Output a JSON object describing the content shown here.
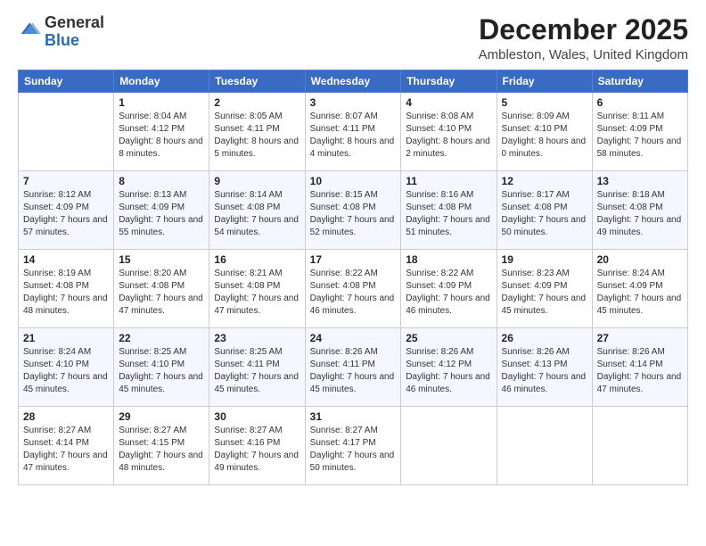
{
  "header": {
    "logo_general": "General",
    "logo_blue": "Blue",
    "month_title": "December 2025",
    "location": "Ambleston, Wales, United Kingdom"
  },
  "days_of_week": [
    "Sunday",
    "Monday",
    "Tuesday",
    "Wednesday",
    "Thursday",
    "Friday",
    "Saturday"
  ],
  "weeks": [
    [
      {
        "day": "",
        "sunrise": "",
        "sunset": "",
        "daylight": ""
      },
      {
        "day": "1",
        "sunrise": "Sunrise: 8:04 AM",
        "sunset": "Sunset: 4:12 PM",
        "daylight": "Daylight: 8 hours and 8 minutes."
      },
      {
        "day": "2",
        "sunrise": "Sunrise: 8:05 AM",
        "sunset": "Sunset: 4:11 PM",
        "daylight": "Daylight: 8 hours and 5 minutes."
      },
      {
        "day": "3",
        "sunrise": "Sunrise: 8:07 AM",
        "sunset": "Sunset: 4:11 PM",
        "daylight": "Daylight: 8 hours and 4 minutes."
      },
      {
        "day": "4",
        "sunrise": "Sunrise: 8:08 AM",
        "sunset": "Sunset: 4:10 PM",
        "daylight": "Daylight: 8 hours and 2 minutes."
      },
      {
        "day": "5",
        "sunrise": "Sunrise: 8:09 AM",
        "sunset": "Sunset: 4:10 PM",
        "daylight": "Daylight: 8 hours and 0 minutes."
      },
      {
        "day": "6",
        "sunrise": "Sunrise: 8:11 AM",
        "sunset": "Sunset: 4:09 PM",
        "daylight": "Daylight: 7 hours and 58 minutes."
      }
    ],
    [
      {
        "day": "7",
        "sunrise": "Sunrise: 8:12 AM",
        "sunset": "Sunset: 4:09 PM",
        "daylight": "Daylight: 7 hours and 57 minutes."
      },
      {
        "day": "8",
        "sunrise": "Sunrise: 8:13 AM",
        "sunset": "Sunset: 4:09 PM",
        "daylight": "Daylight: 7 hours and 55 minutes."
      },
      {
        "day": "9",
        "sunrise": "Sunrise: 8:14 AM",
        "sunset": "Sunset: 4:08 PM",
        "daylight": "Daylight: 7 hours and 54 minutes."
      },
      {
        "day": "10",
        "sunrise": "Sunrise: 8:15 AM",
        "sunset": "Sunset: 4:08 PM",
        "daylight": "Daylight: 7 hours and 52 minutes."
      },
      {
        "day": "11",
        "sunrise": "Sunrise: 8:16 AM",
        "sunset": "Sunset: 4:08 PM",
        "daylight": "Daylight: 7 hours and 51 minutes."
      },
      {
        "day": "12",
        "sunrise": "Sunrise: 8:17 AM",
        "sunset": "Sunset: 4:08 PM",
        "daylight": "Daylight: 7 hours and 50 minutes."
      },
      {
        "day": "13",
        "sunrise": "Sunrise: 8:18 AM",
        "sunset": "Sunset: 4:08 PM",
        "daylight": "Daylight: 7 hours and 49 minutes."
      }
    ],
    [
      {
        "day": "14",
        "sunrise": "Sunrise: 8:19 AM",
        "sunset": "Sunset: 4:08 PM",
        "daylight": "Daylight: 7 hours and 48 minutes."
      },
      {
        "day": "15",
        "sunrise": "Sunrise: 8:20 AM",
        "sunset": "Sunset: 4:08 PM",
        "daylight": "Daylight: 7 hours and 47 minutes."
      },
      {
        "day": "16",
        "sunrise": "Sunrise: 8:21 AM",
        "sunset": "Sunset: 4:08 PM",
        "daylight": "Daylight: 7 hours and 47 minutes."
      },
      {
        "day": "17",
        "sunrise": "Sunrise: 8:22 AM",
        "sunset": "Sunset: 4:08 PM",
        "daylight": "Daylight: 7 hours and 46 minutes."
      },
      {
        "day": "18",
        "sunrise": "Sunrise: 8:22 AM",
        "sunset": "Sunset: 4:09 PM",
        "daylight": "Daylight: 7 hours and 46 minutes."
      },
      {
        "day": "19",
        "sunrise": "Sunrise: 8:23 AM",
        "sunset": "Sunset: 4:09 PM",
        "daylight": "Daylight: 7 hours and 45 minutes."
      },
      {
        "day": "20",
        "sunrise": "Sunrise: 8:24 AM",
        "sunset": "Sunset: 4:09 PM",
        "daylight": "Daylight: 7 hours and 45 minutes."
      }
    ],
    [
      {
        "day": "21",
        "sunrise": "Sunrise: 8:24 AM",
        "sunset": "Sunset: 4:10 PM",
        "daylight": "Daylight: 7 hours and 45 minutes."
      },
      {
        "day": "22",
        "sunrise": "Sunrise: 8:25 AM",
        "sunset": "Sunset: 4:10 PM",
        "daylight": "Daylight: 7 hours and 45 minutes."
      },
      {
        "day": "23",
        "sunrise": "Sunrise: 8:25 AM",
        "sunset": "Sunset: 4:11 PM",
        "daylight": "Daylight: 7 hours and 45 minutes."
      },
      {
        "day": "24",
        "sunrise": "Sunrise: 8:26 AM",
        "sunset": "Sunset: 4:11 PM",
        "daylight": "Daylight: 7 hours and 45 minutes."
      },
      {
        "day": "25",
        "sunrise": "Sunrise: 8:26 AM",
        "sunset": "Sunset: 4:12 PM",
        "daylight": "Daylight: 7 hours and 46 minutes."
      },
      {
        "day": "26",
        "sunrise": "Sunrise: 8:26 AM",
        "sunset": "Sunset: 4:13 PM",
        "daylight": "Daylight: 7 hours and 46 minutes."
      },
      {
        "day": "27",
        "sunrise": "Sunrise: 8:26 AM",
        "sunset": "Sunset: 4:14 PM",
        "daylight": "Daylight: 7 hours and 47 minutes."
      }
    ],
    [
      {
        "day": "28",
        "sunrise": "Sunrise: 8:27 AM",
        "sunset": "Sunset: 4:14 PM",
        "daylight": "Daylight: 7 hours and 47 minutes."
      },
      {
        "day": "29",
        "sunrise": "Sunrise: 8:27 AM",
        "sunset": "Sunset: 4:15 PM",
        "daylight": "Daylight: 7 hours and 48 minutes."
      },
      {
        "day": "30",
        "sunrise": "Sunrise: 8:27 AM",
        "sunset": "Sunset: 4:16 PM",
        "daylight": "Daylight: 7 hours and 49 minutes."
      },
      {
        "day": "31",
        "sunrise": "Sunrise: 8:27 AM",
        "sunset": "Sunset: 4:17 PM",
        "daylight": "Daylight: 7 hours and 50 minutes."
      },
      {
        "day": "",
        "sunrise": "",
        "sunset": "",
        "daylight": ""
      },
      {
        "day": "",
        "sunrise": "",
        "sunset": "",
        "daylight": ""
      },
      {
        "day": "",
        "sunrise": "",
        "sunset": "",
        "daylight": ""
      }
    ]
  ]
}
